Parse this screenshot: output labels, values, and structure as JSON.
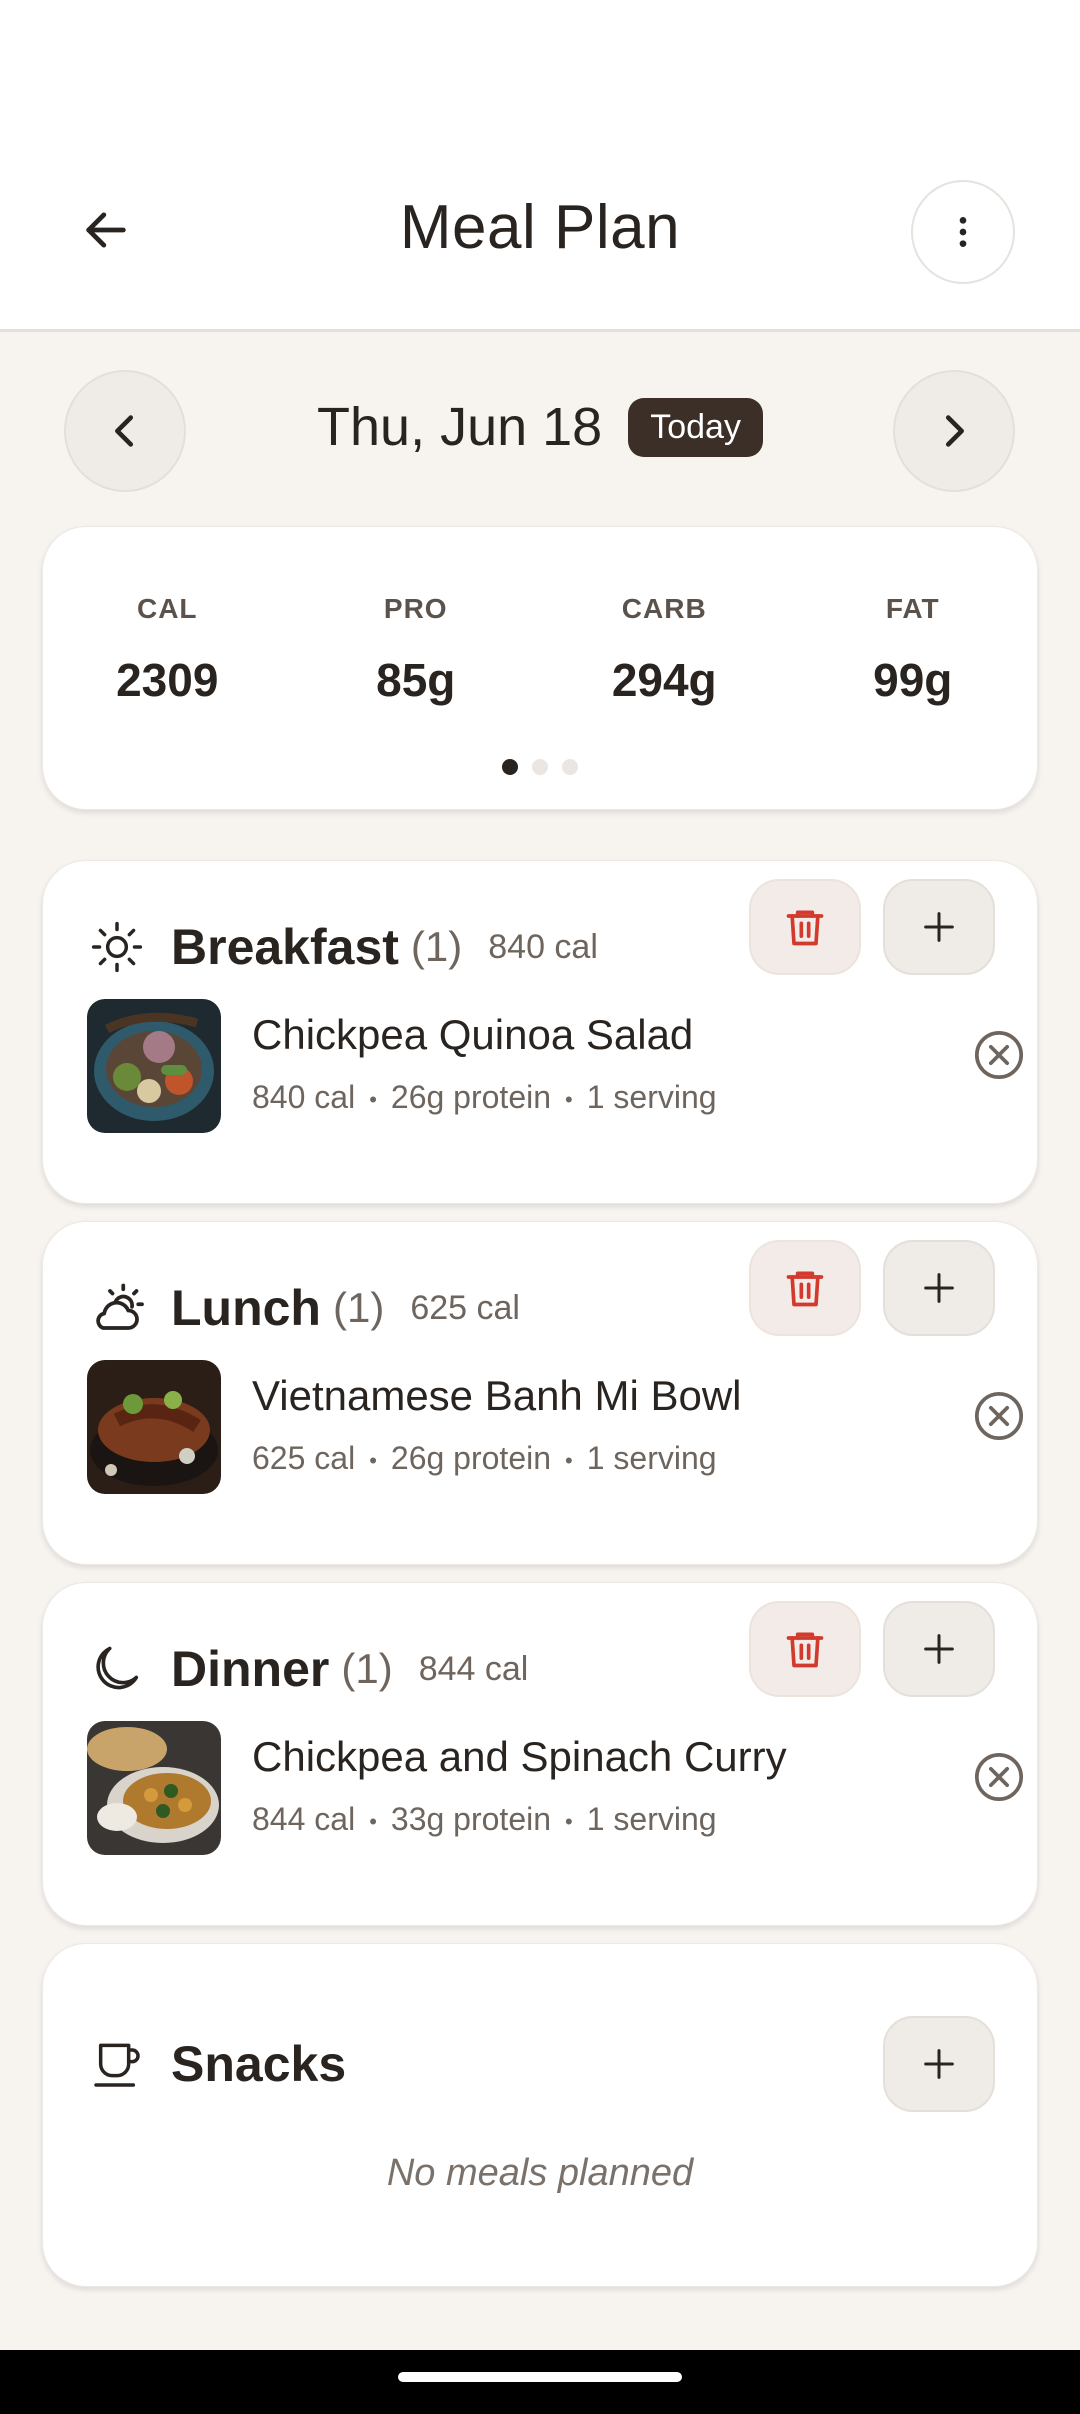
{
  "header": {
    "title": "Meal Plan",
    "back_icon": "arrow-left-icon",
    "more_icon": "more-vertical-icon"
  },
  "date_nav": {
    "date": "Thu, Jun 18",
    "badge": "Today"
  },
  "summary": {
    "stats": [
      {
        "label": "CAL",
        "value": "2309"
      },
      {
        "label": "PRO",
        "value": "85g"
      },
      {
        "label": "CARB",
        "value": "294g"
      },
      {
        "label": "FAT",
        "value": "99g"
      }
    ],
    "page_indicator": {
      "pages": 3,
      "active": 1
    }
  },
  "meals": [
    {
      "name": "Breakfast",
      "count": "(1)",
      "calories": "840 cal",
      "icon": "sun-icon",
      "items": [
        {
          "title": "Chickpea Quinoa Salad",
          "cal": "840 cal",
          "protein": "26g protein",
          "serving": "1 serving"
        }
      ]
    },
    {
      "name": "Lunch",
      "count": "(1)",
      "calories": "625 cal",
      "icon": "partly-cloudy-icon",
      "items": [
        {
          "title": "Vietnamese Banh Mi Bowl",
          "cal": "625 cal",
          "protein": "26g protein",
          "serving": "1 serving"
        }
      ]
    },
    {
      "name": "Dinner",
      "count": "(1)",
      "calories": "844 cal",
      "icon": "moon-icon",
      "items": [
        {
          "title": "Chickpea and Spinach Curry",
          "cal": "844 cal",
          "protein": "33g protein",
          "serving": "1 serving"
        }
      ]
    },
    {
      "name": "Snacks",
      "icon": "cup-icon",
      "empty_text": "No meals planned"
    }
  ],
  "colors": {
    "background": "#f7f4f0",
    "badge": "#3b2f27",
    "delete": "#d23a2e",
    "text": "#2a2420"
  }
}
